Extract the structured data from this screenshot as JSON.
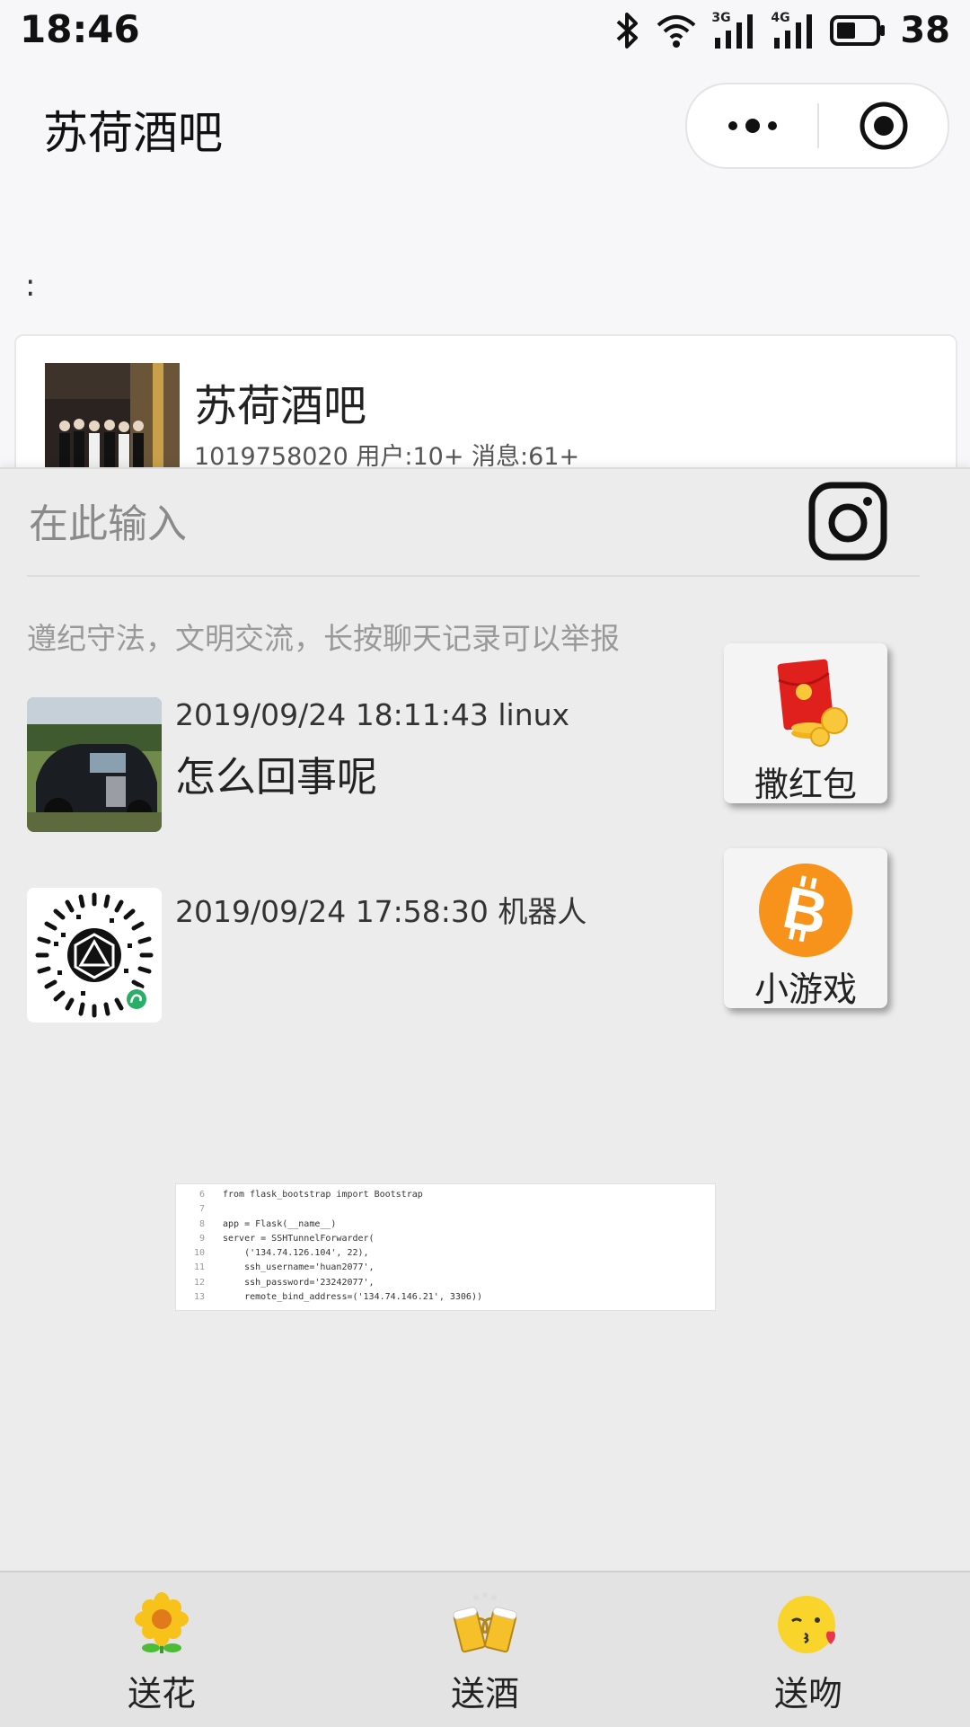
{
  "status_bar": {
    "time": "18:46",
    "battery_level": "38",
    "net_3g": "3G",
    "net_4g": "4G"
  },
  "nav": {
    "title": "苏荷酒吧"
  },
  "page": {
    "colon": ":"
  },
  "group": {
    "name": "苏荷酒吧",
    "meta": "1019758020 用户:10+ 消息:61+"
  },
  "chat": {
    "input_placeholder": "在此输入",
    "notice": "遵纪守法，文明交流，长按聊天记录可以举报",
    "messages": [
      {
        "header": "2019/09/24 18:11:43 linux",
        "text": "怎么回事呢"
      },
      {
        "header": "2019/09/24 17:58:30 机器人",
        "text": ""
      }
    ]
  },
  "side_buttons": {
    "red_packet": "撒红包",
    "game": "小游戏"
  },
  "code_image": {
    "lines": [
      {
        "ln": "6",
        "text": "from flask_bootstrap import Bootstrap"
      },
      {
        "ln": "7",
        "text": ""
      },
      {
        "ln": "8",
        "text": "app = Flask(__name__)"
      },
      {
        "ln": "9",
        "text": "server = SSHTunnelForwarder("
      },
      {
        "ln": "10",
        "text": "    ('134.74.126.104', 22),"
      },
      {
        "ln": "11",
        "text": "    ssh_username='huan2077',"
      },
      {
        "ln": "12",
        "text": "    ssh_password='23242077',"
      },
      {
        "ln": "13",
        "text": "    remote_bind_address=('134.74.146.21', 3306))"
      }
    ]
  },
  "bottom_bar": {
    "flower": "送花",
    "wine": "送酒",
    "kiss": "送吻"
  },
  "colors": {
    "panel_bg": "#ececec",
    "bitcoin": "#f7931a",
    "red_packet": "#e0201c"
  }
}
